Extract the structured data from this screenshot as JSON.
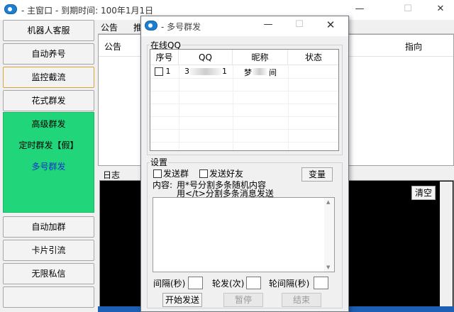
{
  "main_window": {
    "title": "- 主窗口 - 到期时间: 100年1月1日",
    "min_glyph": "—",
    "max_glyph": "☐",
    "close_glyph": "✕",
    "icon": "qq-app-icon"
  },
  "sidebar": {
    "buttons_top": [
      "机器人客服",
      "自动养号",
      "监控截流",
      "花式群发"
    ],
    "green_items": [
      "高级群发",
      "定时群发【假】",
      "多号群发"
    ],
    "buttons_bottom": [
      "自动加群",
      "卡片引流",
      "无限私信"
    ]
  },
  "notice": {
    "tab_notice": "公告",
    "tab_partial": "推",
    "header_notice": "公告",
    "header_guide": "指向"
  },
  "log": {
    "label": "日志",
    "clear_label": "清空"
  },
  "dialog": {
    "title": "- 多号群发",
    "min_glyph": "—",
    "max_glyph": "☐",
    "close_glyph": "✕",
    "online_group_label": "在线QQ",
    "table": {
      "headers": [
        "序号",
        "QQ",
        "昵称",
        "状态"
      ],
      "rows": [
        {
          "index": "1",
          "qq_start": "3",
          "qq_end": "1",
          "nick_start": "梦",
          "nick_end": "间"
        }
      ]
    },
    "settings_group_label": "设置",
    "send_group_label": "发送群",
    "send_friend_label": "发送好友",
    "variable_button": "变量",
    "content_label": "内容:",
    "content_hint_1": "用*号分割多条随机内容",
    "content_hint_2": "用</t>分割多条消息发送",
    "interval_label": "间隔(秒)",
    "rounds_label": "轮发(次)",
    "round_interval_label": "轮间隔(秒)",
    "start_button": "开始发送",
    "pause_button": "暂停",
    "end_button": "结束"
  }
}
